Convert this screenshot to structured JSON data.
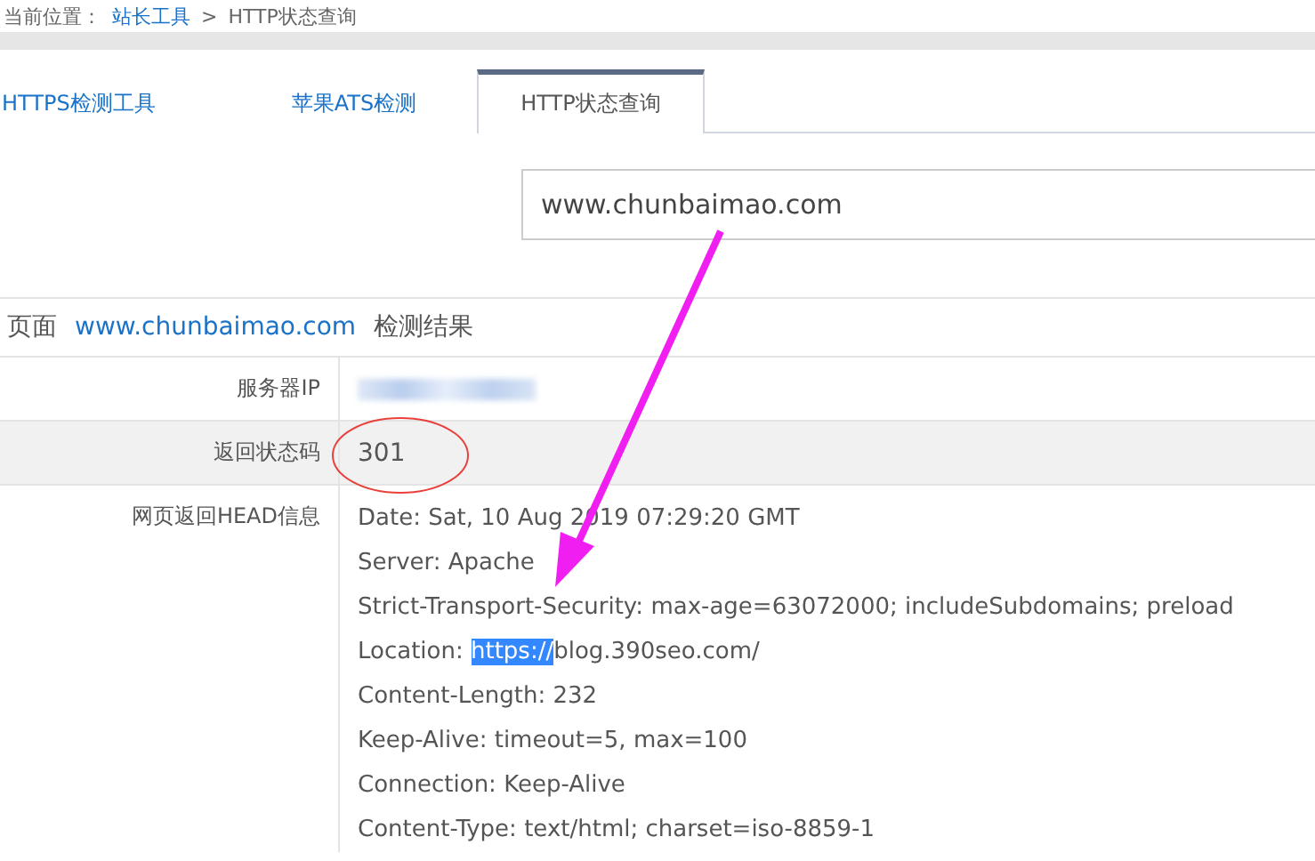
{
  "breadcrumb": {
    "label": "当前位置：",
    "items": [
      {
        "text": "站长工具",
        "link": true
      },
      {
        "text": "HTTP状态查询",
        "link": false
      }
    ],
    "separator": ">"
  },
  "tabs": [
    {
      "label": "HTTPS检测工具",
      "selected": false
    },
    {
      "label": "苹果ATS检测",
      "selected": false
    },
    {
      "label": "HTTP状态查询",
      "selected": true
    }
  ],
  "url_field": {
    "value": "www.chunbaimao.com"
  },
  "result_heading": {
    "prefix": "页面",
    "domain": "www.chunbaimao.com",
    "suffix": "检测结果"
  },
  "result_rows": [
    {
      "kind": "blurred",
      "label": "服务器IP",
      "shaded": false
    },
    {
      "kind": "text",
      "label": "返回状态码",
      "value": "301",
      "shaded": true
    },
    {
      "kind": "lines",
      "label": "网页返回HEAD信息",
      "shaded": false,
      "lines": [
        [
          {
            "text": "Date: Sat, 10 Aug 2019 07:29:20 GMT",
            "selected": false
          }
        ],
        [
          {
            "text": "Server: Apache",
            "selected": false
          }
        ],
        [
          {
            "text": "Strict-Transport-Security: max-age=63072000; includeSubdomains; preload",
            "selected": false
          }
        ],
        [
          {
            "text": "Location: ",
            "selected": false
          },
          {
            "text": "https://",
            "selected": true
          },
          {
            "text": "blog.390seo.com/",
            "selected": false
          }
        ],
        [
          {
            "text": "Content-Length: 232",
            "selected": false
          }
        ],
        [
          {
            "text": "Keep-Alive: timeout=5, max=100",
            "selected": false
          }
        ],
        [
          {
            "text": "Connection: Keep-Alive",
            "selected": false
          }
        ],
        [
          {
            "text": "Content-Type: text/html; charset=iso-8859-1",
            "selected": false
          }
        ]
      ]
    }
  ],
  "annotations": [
    {
      "kind": "ellipse",
      "color": "#e8413c"
    },
    {
      "kind": "arrow",
      "color": "#f01ef0"
    }
  ]
}
